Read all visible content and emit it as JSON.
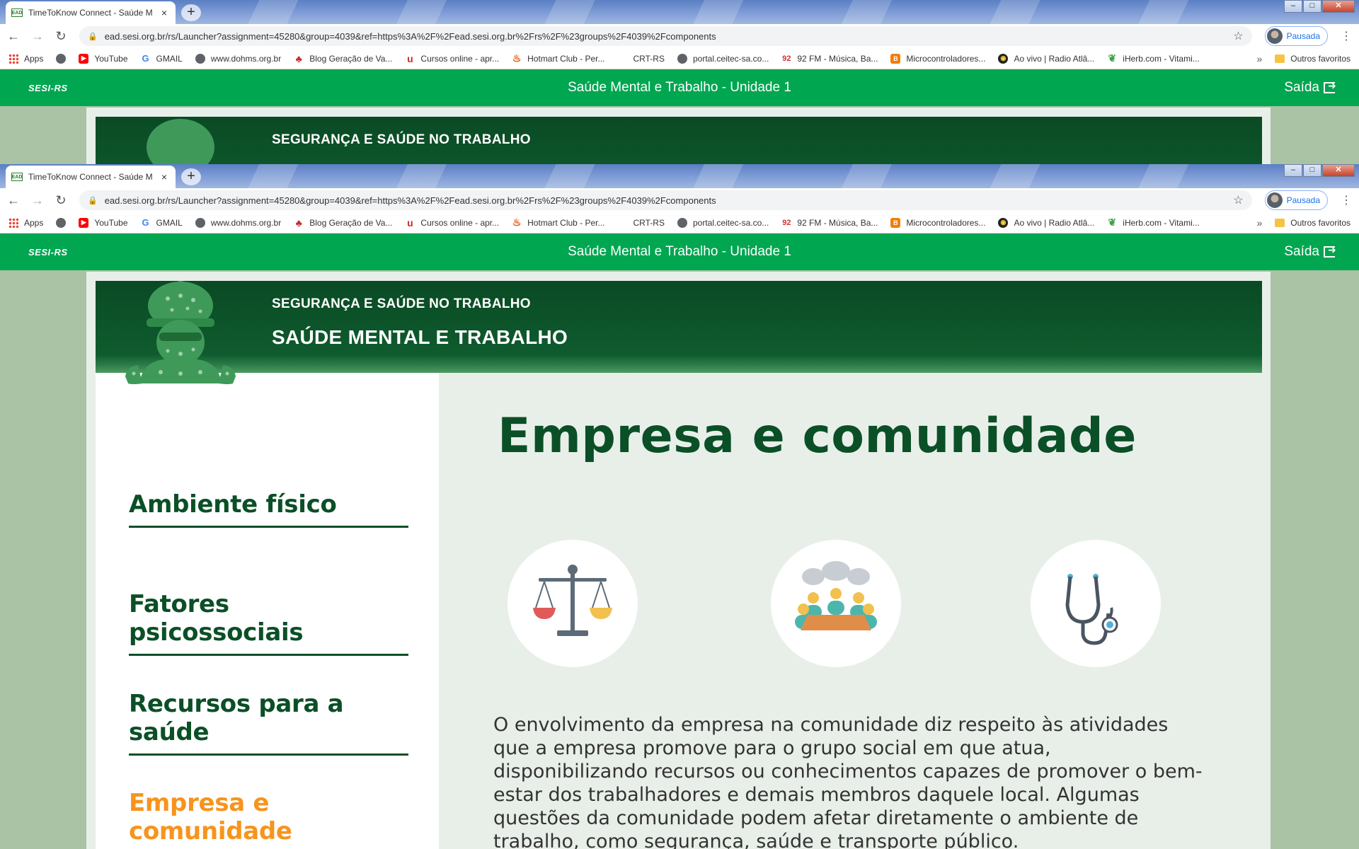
{
  "browser": {
    "tab_title": "TimeToKnow Connect - Saúde M",
    "tab_favicon": "EAD",
    "tab_close": "×",
    "new_tab": "+",
    "url": "ead.sesi.org.br/rs/Launcher?assignment=45280&group=4039&ref=https%3A%2F%2Fead.sesi.org.br%2Frs%2F%23groups%2F4039%2Fcomponents",
    "profile_label": "Pausada",
    "window_controls": {
      "minimize": "–",
      "maximize": "□",
      "close": "✕"
    },
    "nav": {
      "back": "←",
      "forward": "→",
      "reload": "↻",
      "star": "☆",
      "menu": "⋮",
      "lock": "🔒"
    },
    "bookmarks": [
      {
        "label": "Apps",
        "icon": "apps-grid-icon"
      },
      {
        "label": "",
        "icon": "globe-icon"
      },
      {
        "label": "YouTube",
        "icon": "youtube-icon"
      },
      {
        "label": "GMAIL",
        "icon": "google-icon"
      },
      {
        "label": "www.dohms.org.br",
        "icon": "globe-icon"
      },
      {
        "label": "Blog Geração de Va...",
        "icon": "club-icon"
      },
      {
        "label": "Cursos online - apr...",
        "icon": "udemy-icon"
      },
      {
        "label": "Hotmart Club - Per...",
        "icon": "flame-icon"
      },
      {
        "label": "CRT-RS",
        "icon": "blank-icon"
      },
      {
        "label": "portal.ceitec-sa.co...",
        "icon": "globe-icon"
      },
      {
        "label": "92 FM - Música, Ba...",
        "icon": "radio-92-icon"
      },
      {
        "label": "Microcontroladores...",
        "icon": "blogger-icon"
      },
      {
        "label": "Ao vivo | Radio Atlâ...",
        "icon": "radio-icon"
      },
      {
        "label": "iHerb.com - Vitami...",
        "icon": "leaf-icon"
      }
    ],
    "bookmarks_more": "»",
    "other_bookmarks": "Outros favoritos"
  },
  "app": {
    "brand": "SESI-RS",
    "title": "Saúde Mental e Trabalho - Unidade 1",
    "exit_label": "Saída"
  },
  "banner": {
    "kicker": "SEGURANÇA E SAÚDE NO TRABALHO",
    "title": "SAÚDE MENTAL E TRABALHO"
  },
  "sidebar": {
    "items": [
      {
        "label": "Ambiente físico",
        "active": false
      },
      {
        "label": "Fatores psicossociais",
        "active": false
      },
      {
        "label": "Recursos para a saúde",
        "active": false
      },
      {
        "label": "Empresa e comunidade",
        "active": true
      }
    ]
  },
  "content": {
    "heading": "Empresa e comunidade",
    "icons": [
      "scales-icon",
      "meeting-icon",
      "stethoscope-icon"
    ],
    "body": "O envolvimento da empresa na comunidade diz respeito às atividades que a empresa promove para o grupo social em que atua, disponibilizando recursos ou conhecimentos capazes de promover o bem-estar dos trabalhadores e demais membros daquele local.  Algumas questões da comunidade podem afetar diretamente o ambiente de trabalho, como segurança, saúde e transporte público."
  },
  "colors": {
    "brand_green": "#00a650",
    "dark_green": "#0b4f27",
    "active_orange": "#f7941d",
    "page_bg": "#e8efe9"
  }
}
